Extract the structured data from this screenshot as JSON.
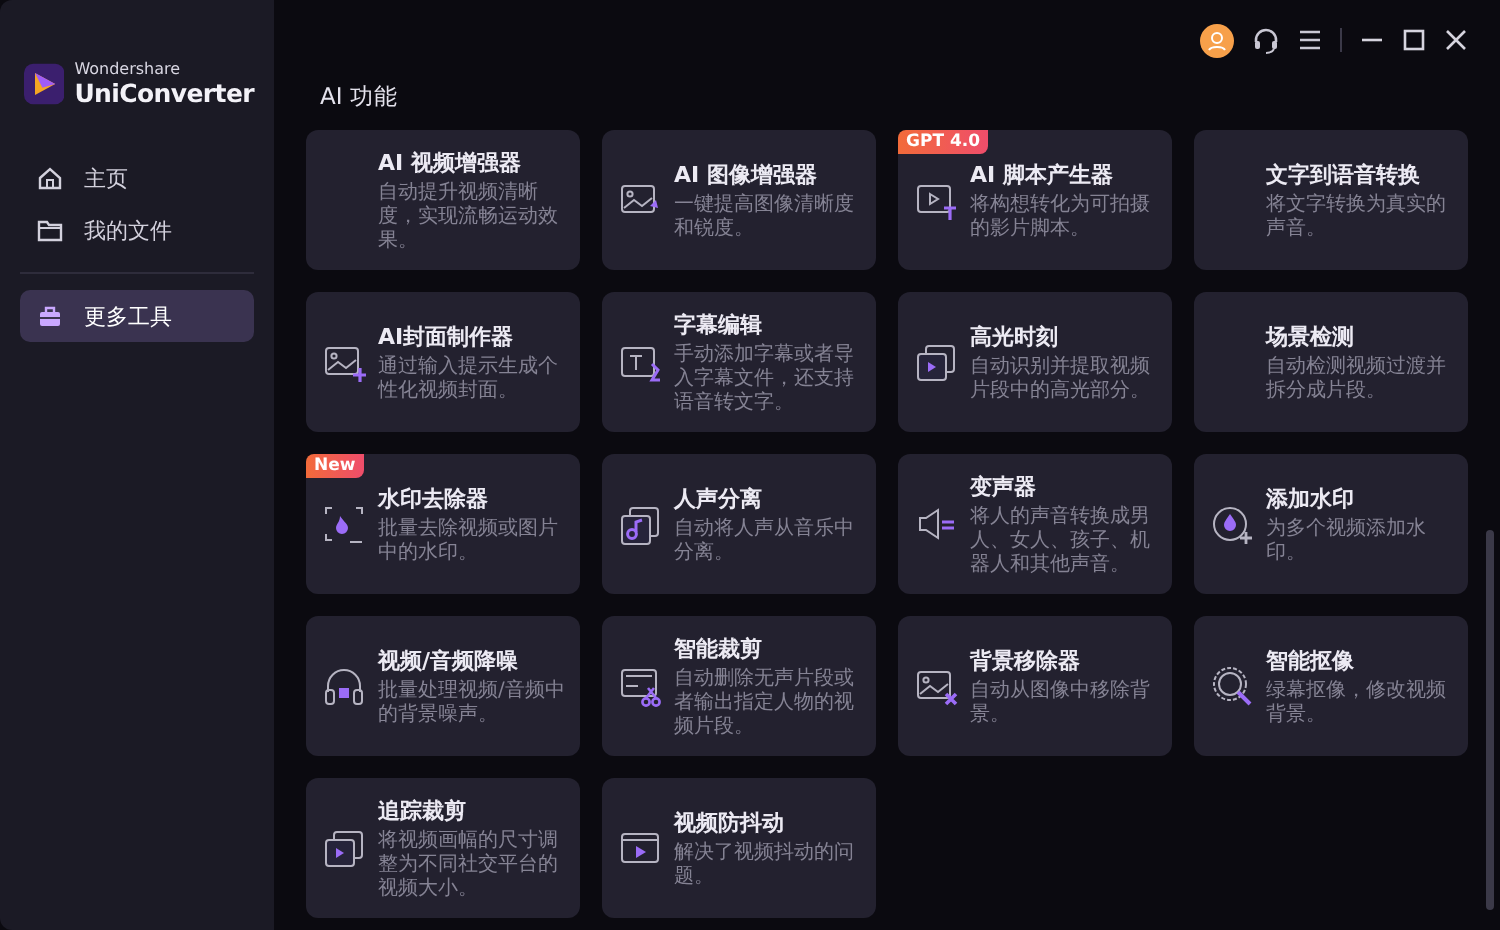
{
  "app": {
    "brand_small": "Wondershare",
    "brand_name": "UniConverter"
  },
  "sidebar": {
    "items": [
      {
        "label": "主页",
        "selected": false
      },
      {
        "label": "我的文件",
        "selected": false
      },
      {
        "label": "更多工具",
        "selected": true
      }
    ]
  },
  "section_title": "AI 功能",
  "tools": [
    {
      "title": "AI 视频增强器",
      "description": "自动提升视频清晰度，实现流畅运动效果。"
    },
    {
      "title": "AI 图像增强器",
      "description": "一键提高图像清晰度和锐度。"
    },
    {
      "title": "AI 脚本产生器",
      "description": "将构想转化为可拍摄的影片脚本。",
      "badge": "GPT 4.0"
    },
    {
      "title": "文字到语音转换",
      "description": "将文字转换为真实的声音。"
    },
    {
      "title": "AI封面制作器",
      "description": "通过输入提示生成个性化视频封面。"
    },
    {
      "title": "字幕编辑",
      "description": "手动添加字幕或者导入字幕文件，还支持语音转文字。"
    },
    {
      "title": "高光时刻",
      "description": "自动识别并提取视频片段中的高光部分。"
    },
    {
      "title": "场景检测",
      "description": "自动检测视频过渡并拆分成片段。"
    },
    {
      "title": "水印去除器",
      "description": "批量去除视频或图片中的水印。",
      "badge": "New"
    },
    {
      "title": "人声分离",
      "description": "自动将人声从音乐中分离。"
    },
    {
      "title": "变声器",
      "description": "将人的声音转换成男人、女人、孩子、机器人和其他声音。"
    },
    {
      "title": "添加水印",
      "description": "为多个视频添加水印。"
    },
    {
      "title": "视频/音频降噪",
      "description": "批量处理视频/音频中的背景噪声。"
    },
    {
      "title": "智能裁剪",
      "description": "自动删除无声片段或者输出指定人物的视频片段。"
    },
    {
      "title": "背景移除器",
      "description": "自动从图像中移除背景。"
    },
    {
      "title": "智能抠像",
      "description": "绿幕抠像，修改视频背景。"
    },
    {
      "title": "追踪裁剪",
      "description": "将视频画幅的尺寸调整为不同社交平台的视频大小。"
    },
    {
      "title": "视频防抖动",
      "description": "解决了视频抖动的问题。"
    }
  ]
}
